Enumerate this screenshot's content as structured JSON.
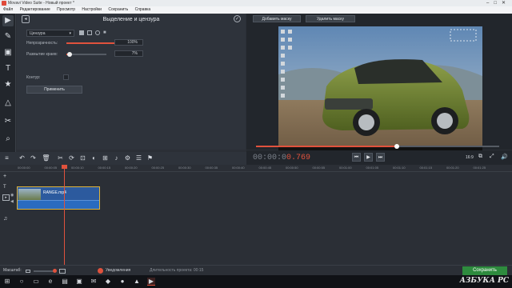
{
  "window": {
    "title": "Movavi Video Suite - Новый проект *"
  },
  "menu": [
    "Файл",
    "Редактирование",
    "Просмотр",
    "Настройки",
    "Сохранить",
    "Справка"
  ],
  "panel": {
    "title": "Выделение и цензура",
    "mode": "Цензура",
    "opacity_label": "Непрозрачность:",
    "opacity_value": "100%",
    "opacity_level": 1.0,
    "blur_label": "Размытие краев:",
    "blur_value": "7%",
    "blur_level": 0.07,
    "outline_label": "Контур:",
    "apply_label": "Применить"
  },
  "preview": {
    "add_mask": "Добавить маску",
    "delete_mask": "Удалить маску",
    "timecode_dim": "00:00:0",
    "timecode_main": "0.769",
    "progress": 0.58,
    "aspect": "16:9"
  },
  "timeline": {
    "ticks": [
      "00:00:00",
      "00:00:05",
      "00:00:10",
      "00:00:15",
      "00:00:20",
      "00:00:25",
      "00:00:30",
      "00:00:35",
      "00:00:40",
      "00:00:45",
      "00:00:50",
      "00:00:55",
      "00:01:00",
      "00:01:05",
      "00:01:10",
      "00:01:15",
      "00:01:20",
      "00:01:25"
    ],
    "clip_name": "RANGE.mp4"
  },
  "status": {
    "zoom_label": "Масштаб:",
    "notifications": "Уведомления",
    "duration": "Длительность проекта: 00:15",
    "save": "Сохранить"
  },
  "watermark": "АЗБУКА РС",
  "colors": {
    "accent": "#e0523d",
    "save": "#2e8b3e",
    "clip": "#2c5a9e"
  }
}
